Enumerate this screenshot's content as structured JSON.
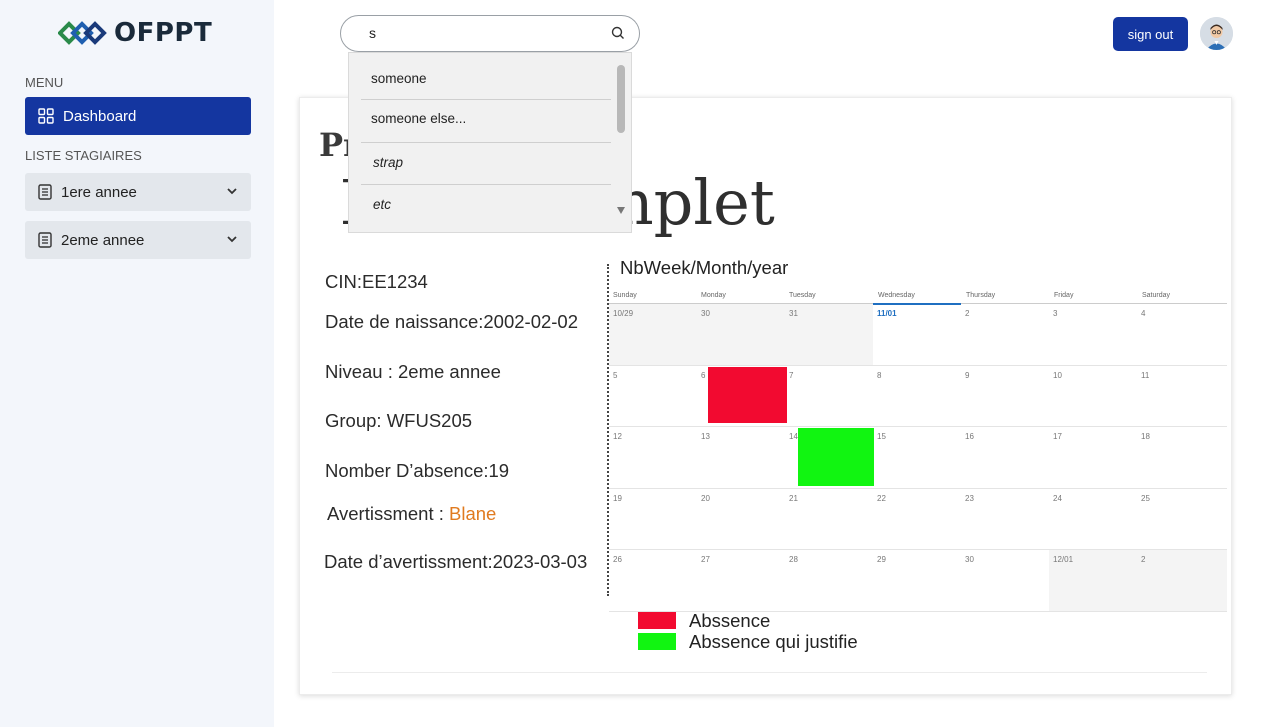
{
  "brand": {
    "name": "OFPPT"
  },
  "sidebar": {
    "menu_label": "MENU",
    "dashboard_label": "Dashboard",
    "section_label": "LISTE STAGIAIRES",
    "items": [
      {
        "label": "1ere annee"
      },
      {
        "label": "2eme annee"
      }
    ]
  },
  "search": {
    "value": "s",
    "suggestions": [
      "someone",
      "someone else...",
      "strap",
      "etc"
    ]
  },
  "header": {
    "signout_label": "sign out"
  },
  "profile": {
    "title": "Profile de",
    "name": "Nom Complet",
    "cin": "CIN:EE1234",
    "birth": "Date de naissance:2002-02-02",
    "level": "Niveau : 2eme annee",
    "group": "Group: WFUS205",
    "absences": "Nomber D’absence:19",
    "warning_label": "Avertissment :",
    "warning_value": "Blane",
    "warning_date": "Date d’avertissment:2023-03-03"
  },
  "calendar": {
    "title": "NbWeek/Month/year",
    "days": [
      "Sunday",
      "Monday",
      "Tuesday",
      "Wednesday",
      "Thursday",
      "Friday",
      "Saturday"
    ],
    "weeks": [
      [
        "10/29",
        "30",
        "31",
        "11/01",
        "2",
        "3",
        "4"
      ],
      [
        "5",
        "6",
        "7",
        "8",
        "9",
        "10",
        "11"
      ],
      [
        "12",
        "13",
        "14",
        "15",
        "16",
        "17",
        "18"
      ],
      [
        "19",
        "20",
        "21",
        "22",
        "23",
        "24",
        "25"
      ],
      [
        "26",
        "27",
        "28",
        "29",
        "30",
        "12/01",
        "2"
      ]
    ],
    "absence_color": "#f20a30",
    "justified_color": "#11f511"
  },
  "legend": {
    "absence": "Abssence",
    "justified": "Abssence qui justifie"
  }
}
